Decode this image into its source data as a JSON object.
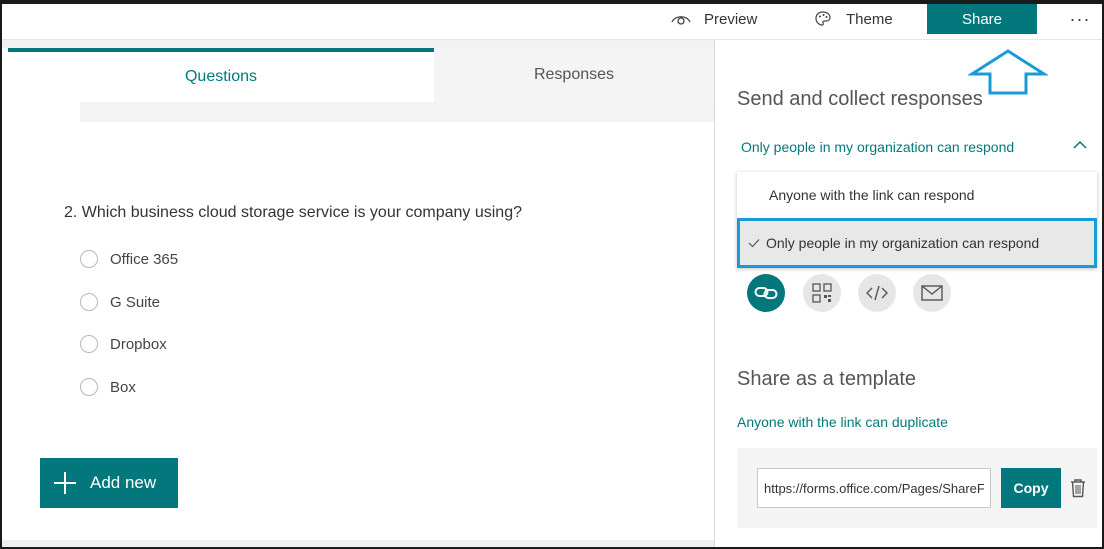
{
  "topbar": {
    "preview_label": "Preview",
    "theme_label": "Theme",
    "share_label": "Share",
    "more_label": "···",
    "icons": [
      "eye-icon",
      "palette-icon",
      "more-icon"
    ]
  },
  "tabs": {
    "questions": "Questions",
    "responses": "Responses"
  },
  "question": {
    "title": "2. Which business cloud storage service is your company using?",
    "options": [
      "Office 365",
      "G Suite",
      "Dropbox",
      "Box"
    ]
  },
  "add_new_label": "Add new",
  "share_panel": {
    "send_heading": "Send and collect responses",
    "permission_selected": "Only people in my organization can respond",
    "dropdown_options": [
      "Anyone with the link can respond",
      "Only people in my organization can respond"
    ],
    "share_methods": [
      "link-icon",
      "qr-code-icon",
      "embed-icon",
      "email-icon"
    ],
    "template_heading": "Share as a template",
    "template_link_text": "Anyone with the link can duplicate",
    "url_value": "https://forms.office.com/Pages/ShareFormPage.aspx",
    "copy_label": "Copy"
  },
  "colors": {
    "accent": "#03787c",
    "highlight": "#1a9bd6"
  }
}
